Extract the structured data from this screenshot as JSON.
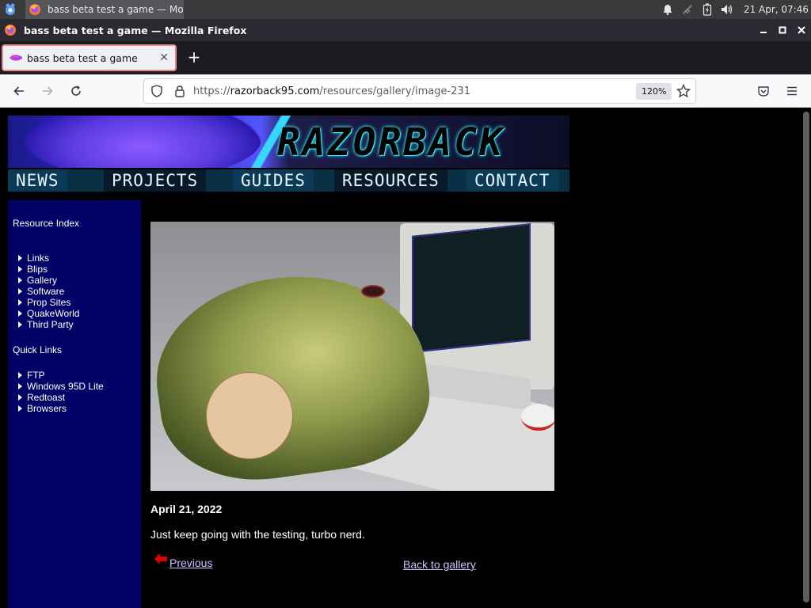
{
  "taskbar": {
    "menu_icon": "mascot-menu-icon",
    "task_title": "bass beta test a game — Mo...",
    "tray_icons": [
      "bell-icon",
      "network-disconnected-icon",
      "battery-charging-icon",
      "volume-icon"
    ],
    "clock": "21 Apr, 07:46"
  },
  "window": {
    "title": "bass beta test a game — Mozilla Firefox",
    "controls": [
      "minimize-icon",
      "maximize-icon",
      "close-icon"
    ]
  },
  "tabs": [
    {
      "label": "bass beta test a game",
      "active": true
    }
  ],
  "newtab_label": "+",
  "url": {
    "scheme": "https://",
    "host": "razorback95.com",
    "path": "/resources/gallery/image-231",
    "zoom": "120%"
  },
  "site": {
    "logo_text": "RAZORBACK",
    "nav": [
      "NEWS",
      "PROJECTS",
      "GUIDES",
      "RESOURCES",
      "CONTACT"
    ],
    "sidebar": {
      "heading1": "Resource Index",
      "list1": [
        "Links",
        "Blips",
        "Gallery",
        "Software",
        "Prop Sites",
        "QuakeWorld",
        "Third Party"
      ],
      "heading2": "Quick Links",
      "list2": [
        "FTP",
        "Windows 95D Lite",
        "Redtoast",
        "Browsers"
      ]
    },
    "post": {
      "date": "April 21, 2022",
      "caption": "Just keep going with the testing, turbo nerd.",
      "prev_label": "Previous",
      "back_label": "Back to gallery"
    }
  },
  "colors": {
    "sidebar_bg": "#000066",
    "link": "#c8c8ff",
    "nav_bg": "#0a3045"
  }
}
